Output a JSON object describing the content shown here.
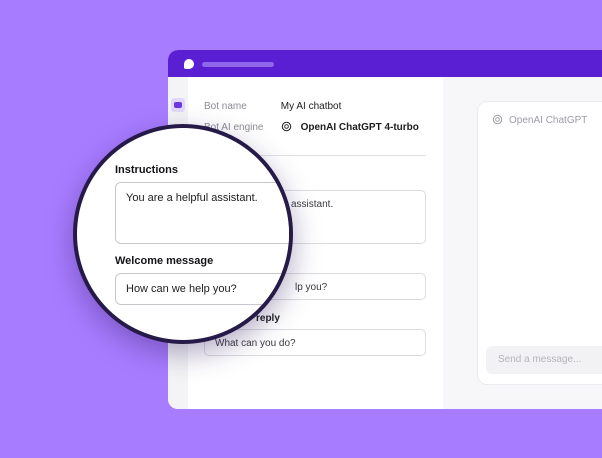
{
  "config": {
    "bot_name_label": "Bot name",
    "bot_name_value": "My AI chatbot",
    "engine_label": "Bot AI engine",
    "engine_value": "OpenAI ChatGPT 4-turbo",
    "instructions_partial": "assistant.",
    "welcome_partial": "lp you?",
    "suggested_reply_label_partial": "reply",
    "suggested_reply_value": "What can you do?"
  },
  "magnifier": {
    "instructions_label": "Instructions",
    "instructions_value": "You are a helpful assistant.",
    "welcome_label": "Welcome message",
    "welcome_value": "How can we help you?"
  },
  "chat_preview": {
    "header": "OpenAI ChatGPT",
    "input_placeholder": "Send a message..."
  },
  "colors": {
    "background": "#a87cff",
    "titlebar": "#5a1fd3",
    "magnifier_border": "#261a48"
  }
}
